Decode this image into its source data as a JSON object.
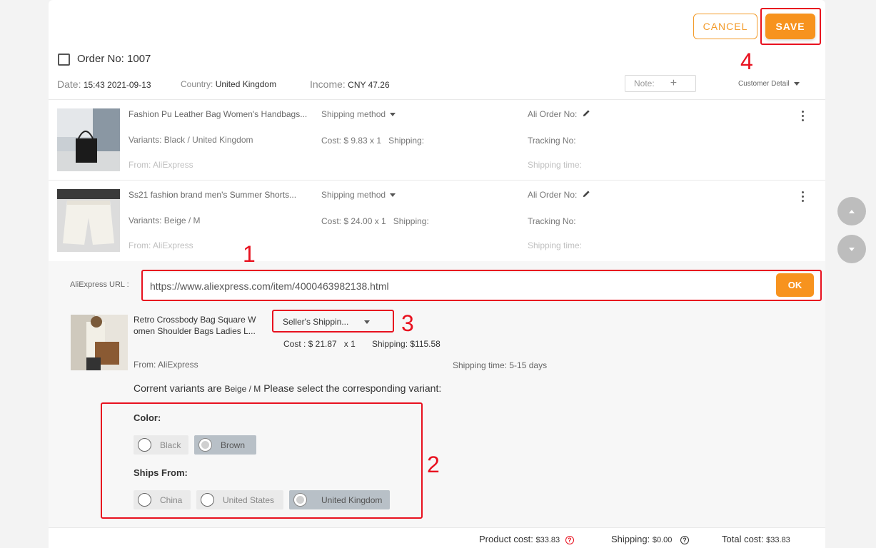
{
  "header": {
    "cancel_label": "CANCEL",
    "save_label": "SAVE",
    "order_label": "Order No: 1007",
    "date_label": "Date:",
    "date_value": "15:43 2021-09-13",
    "country_label": "Country:",
    "country_value": "United Kingdom",
    "income_label": "Income:",
    "income_value": "CNY 47.26",
    "note_label": "Note:",
    "note_plus": "+",
    "customer_detail": "Customer Detail"
  },
  "items": [
    {
      "title": "Fashion Pu Leather Bag Women's Handbags...",
      "variants": "Variants: Black / United Kingdom",
      "from": "From: AliExpress",
      "shipping_method": "Shipping method",
      "cost": "Cost: $ 9.83 x 1",
      "shipping": "Shipping:",
      "ali_order": "Ali Order No:",
      "tracking": "Tracking No:",
      "shipping_time": "Shipping time:"
    },
    {
      "title": "Ss21 fashion brand men's Summer Shorts...",
      "variants": "Variants: Beige / M",
      "from": "From: AliExpress",
      "shipping_method": "Shipping method",
      "cost": "Cost: $ 24.00 x 1",
      "shipping": "Shipping:",
      "ali_order": "Ali Order No:",
      "tracking": "Tracking No:",
      "shipping_time": "Shipping time:"
    }
  ],
  "mapping": {
    "url_label": "AliExpress URL :",
    "url_value": "https://www.aliexpress.com/item/4000463982138.html",
    "ok_label": "OK",
    "product_title_1": "Retro Crossbody Bag Square W",
    "product_title_2": "omen Shoulder Bags Ladies L...",
    "shipping_select": "Seller's Shippin...",
    "cost": "Cost : $ 21.87",
    "qty": "x 1",
    "shipping": "Shipping: $115.58",
    "from": "From: AliExpress",
    "shipping_time": "Shipping time: 5-15 days",
    "current_prefix": "Corrent variants are",
    "current_value": "Beige / M",
    "current_suffix": "Please select the corresponding variant:",
    "color_label": "Color:",
    "color_options": [
      "Black",
      "Brown"
    ],
    "color_selected": "Brown",
    "ships_label": "Ships From:",
    "ships_options": [
      "China",
      "United States",
      "United Kingdom"
    ],
    "ships_selected": "United Kingdom"
  },
  "annotations": [
    "1",
    "2",
    "3",
    "4"
  ],
  "footer": {
    "product_cost_label": "Product cost:",
    "product_cost_value": "$33.83",
    "shipping_label": "Shipping:",
    "shipping_value": "$0.00",
    "total_label": "Total cost:",
    "total_value": "$33.83",
    "help_glyph": "?"
  },
  "colors": {
    "accent": "#f7931e",
    "annotation_red": "#e8111f"
  }
}
